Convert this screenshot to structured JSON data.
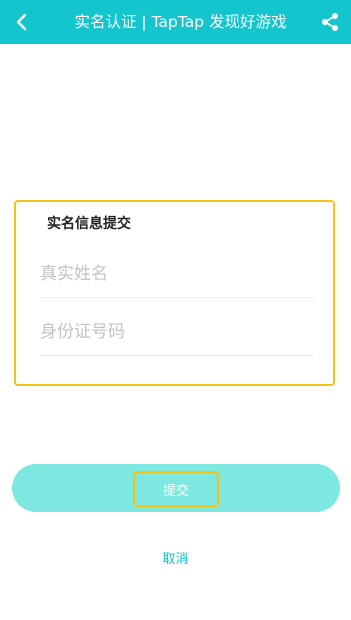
{
  "header": {
    "title": "实名认证 | TapTap 发现好游戏",
    "back_icon": "chevron-left-icon",
    "share_icon": "share-icon",
    "background_color": "#15c5ce"
  },
  "form": {
    "title": "实名信息提交",
    "name_field": {
      "placeholder": "真实姓名",
      "value": ""
    },
    "id_field": {
      "placeholder": "身份证号码",
      "value": ""
    },
    "highlight_color": "#f4c414"
  },
  "actions": {
    "submit_label": "提交",
    "submit_color": "#7de8e0",
    "cancel_label": "取消",
    "cancel_color": "#15c5ce"
  }
}
